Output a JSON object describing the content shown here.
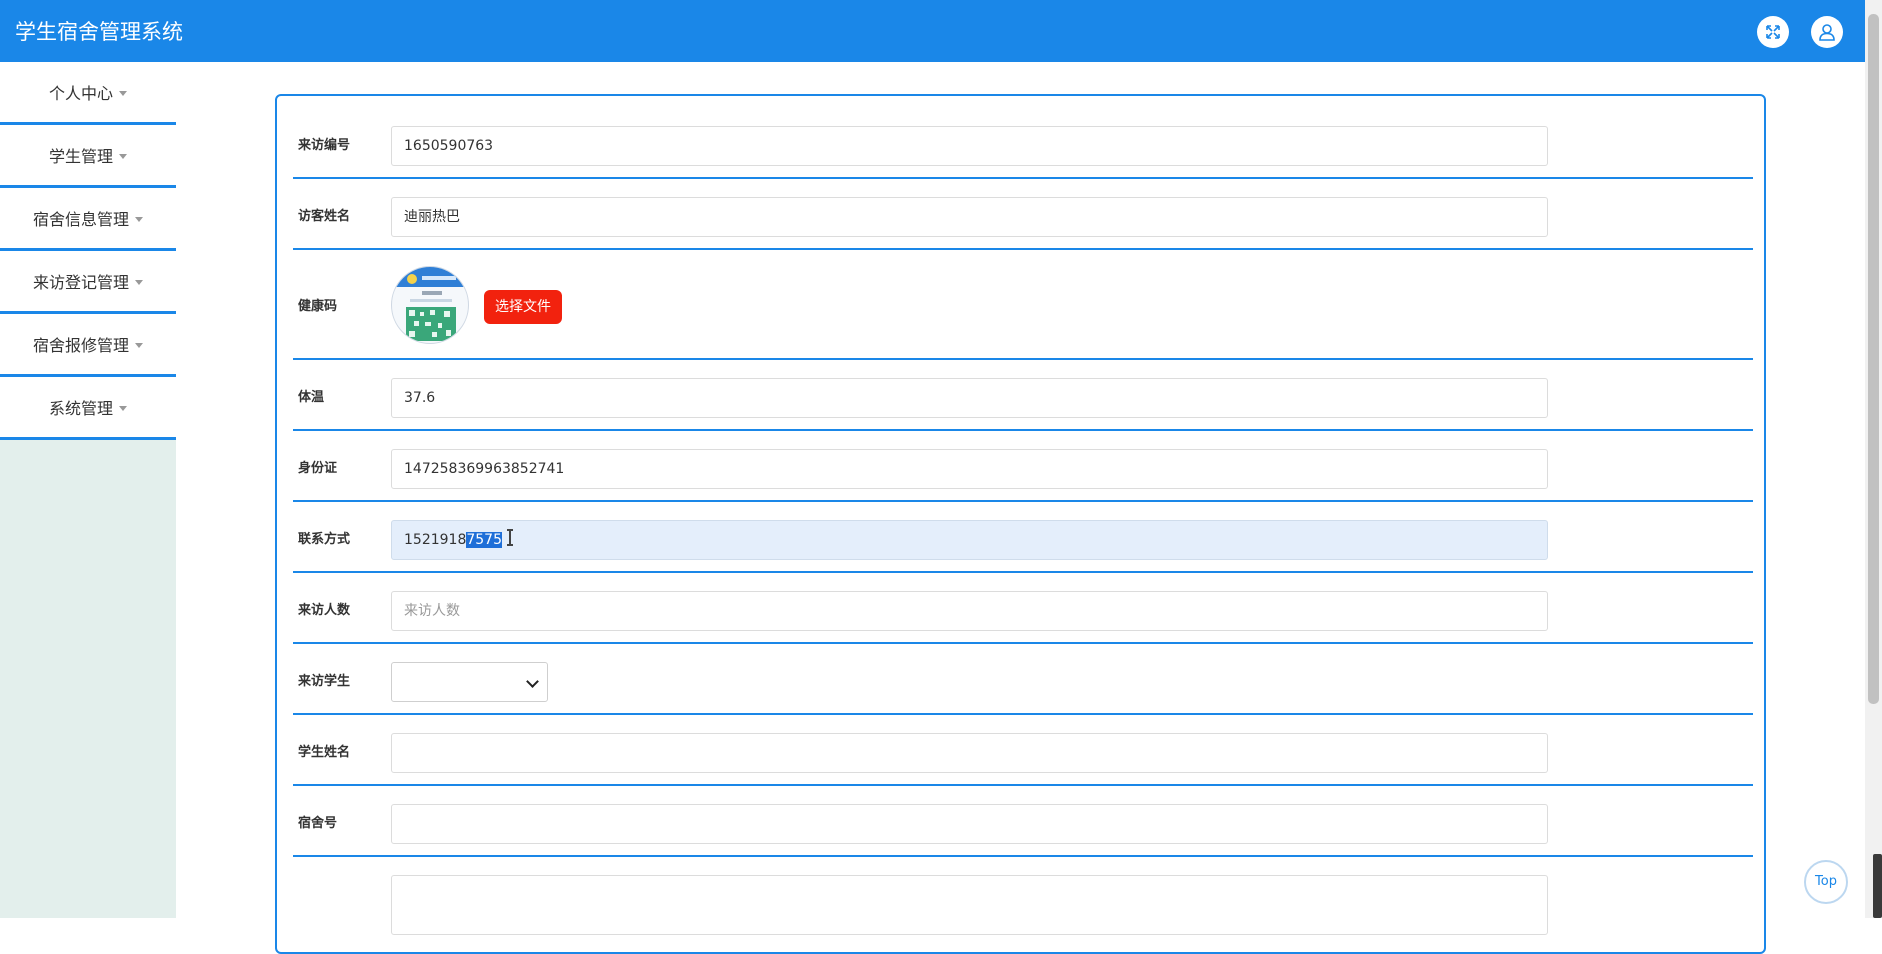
{
  "app": {
    "title": "学生宿舍管理系统"
  },
  "header": {
    "fullscreen_icon": "expand-icon",
    "user_icon": "user-icon"
  },
  "sidebar": {
    "items": [
      {
        "label": "个人中心"
      },
      {
        "label": "学生管理"
      },
      {
        "label": "宿舍信息管理"
      },
      {
        "label": "来访登记管理"
      },
      {
        "label": "宿舍报修管理"
      },
      {
        "label": "系统管理"
      }
    ]
  },
  "form": {
    "visit_no": {
      "label": "来访编号",
      "value": "1650590763"
    },
    "visitor_name": {
      "label": "访客姓名",
      "value": "迪丽热巴"
    },
    "health_code": {
      "label": "健康码",
      "button": "选择文件"
    },
    "temperature": {
      "label": "体温",
      "value": "37.6"
    },
    "id_card": {
      "label": "身份证",
      "value": "147258369963852741"
    },
    "contact": {
      "label": "联系方式",
      "value_prefix": "1521918",
      "value_selected": "7575"
    },
    "visitor_count": {
      "label": "来访人数",
      "placeholder": "来访人数"
    },
    "student": {
      "label": "来访学生",
      "value": ""
    },
    "student_name": {
      "label": "学生姓名",
      "value": ""
    },
    "dorm_no": {
      "label": "宿舍号",
      "value": ""
    }
  },
  "top_button": {
    "label": "Top"
  },
  "colors": {
    "primary": "#1a87e8",
    "danger": "#f2220e",
    "sidebar_bg": "#e3efec"
  }
}
